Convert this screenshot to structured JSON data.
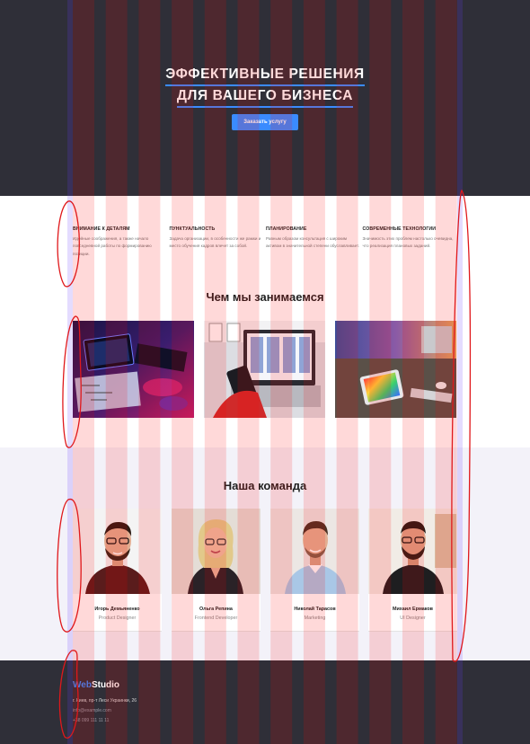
{
  "hero": {
    "title_line1": "ЭФФЕКТИВНЫЕ РЕШЕНИЯ",
    "title_line2": "ДЛЯ ВАШЕГО БИЗНЕСА",
    "cta_label": "Заказать услугу"
  },
  "features": [
    {
      "title": "ВНИМАНИЕ К ДЕТАЛЯМ",
      "text": "Идейные соображения, а также начало повседневной работы по формированию позиции."
    },
    {
      "title": "ПУНКТУАЛЬНОСТЬ",
      "text": "Задача организации, в особенности же рамки и место обучения кадров влечет за собой."
    },
    {
      "title": "ПЛАНИРОВАНИЕ",
      "text": "Равным образом консультация с широким активом в значительной степени обуславливает."
    },
    {
      "title": "СОВРЕМЕННЫЕ ТЕХНОЛОГИИ",
      "text": "Значимость этих проблем настолько очевидна, что реализация плановых заданий."
    }
  ],
  "works": {
    "title": "Чем мы занимаемся",
    "items": [
      "work-image-coding",
      "work-image-mobile-design",
      "work-image-color-palette"
    ]
  },
  "team": {
    "title": "Наша команда",
    "members": [
      {
        "name": "Игорь Демьяненко",
        "role": "Product Designer"
      },
      {
        "name": "Ольга Репина",
        "role": "Frontend Developer"
      },
      {
        "name": "Николай Тарасов",
        "role": "Marketing"
      },
      {
        "name": "Михаил Ермаков",
        "role": "UI Designer"
      }
    ]
  },
  "footer": {
    "logo_web": "Web",
    "logo_studio": "Studio",
    "address": "г. Киев, пр-т Леси Украинки, 26",
    "email": "info@example.com",
    "phone": "+38 099 111 11 11"
  },
  "colors": {
    "dark": "#2f2f38",
    "accent": "#3a8bff",
    "team_bg": "#f3f2f9",
    "grid_overlay": "#ff000026",
    "annotation": "#e0181b"
  }
}
